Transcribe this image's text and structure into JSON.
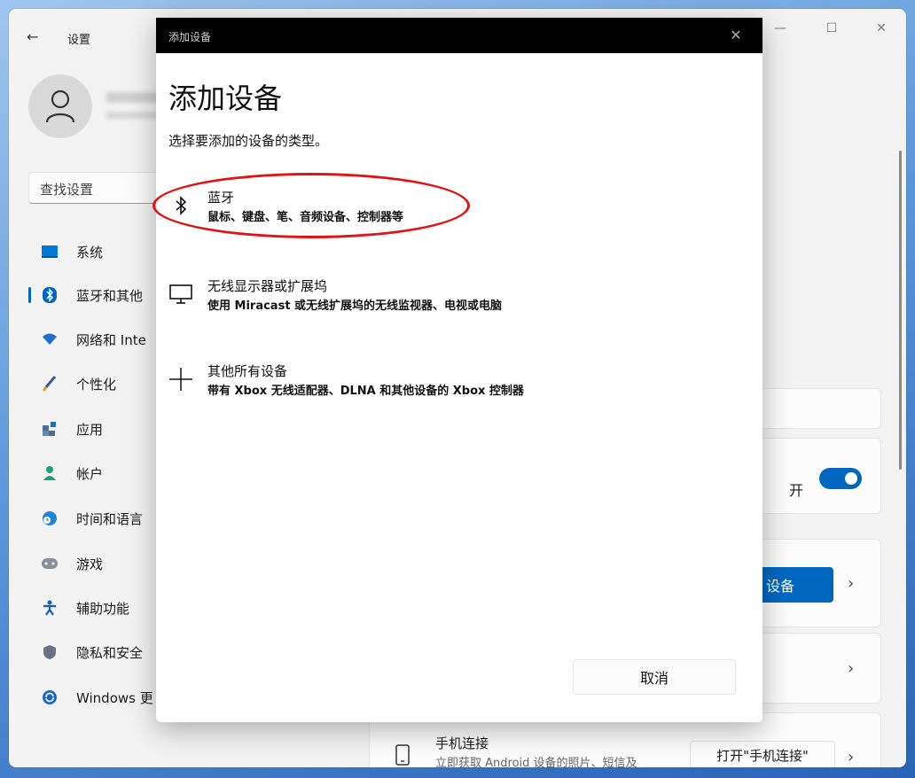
{
  "settings_window": {
    "title": "设置",
    "back_icon": "←",
    "window_controls": [
      "—",
      "☐",
      "✕"
    ],
    "search_placeholder": "查找设置",
    "nav": [
      {
        "label": "系统",
        "icon": "monitor-icon",
        "color": "#0078d4"
      },
      {
        "label": "蓝牙和其他",
        "icon": "bluetooth-icon",
        "color": "#0067c0",
        "active": true
      },
      {
        "label": "网络和 Inte",
        "icon": "wifi-icon",
        "color": "#1d6fcf"
      },
      {
        "label": "个性化",
        "icon": "brush-icon",
        "color": "#3a5a9b"
      },
      {
        "label": "应用",
        "icon": "apps-icon",
        "color": "#4d6e99"
      },
      {
        "label": "帐户",
        "icon": "account-icon",
        "color": "#1aa37a"
      },
      {
        "label": "时间和语言",
        "icon": "globe-clock-icon",
        "color": "#1f85d6"
      },
      {
        "label": "游戏",
        "icon": "gamepad-icon",
        "color": "#8a8f98"
      },
      {
        "label": "辅助功能",
        "icon": "accessibility-icon",
        "color": "#1060b8"
      },
      {
        "label": "隐私和安全",
        "icon": "shield-icon",
        "color": "#6a7280"
      },
      {
        "label": "Windows 更",
        "icon": "update-icon",
        "color": "#1668c4"
      }
    ],
    "toggle_label": "开",
    "add_device_label": "设备",
    "phone_link": {
      "title": "手机连接",
      "desc": "立即获取 Android 设备的照片、短信及",
      "button": "打开\"手机连接\""
    }
  },
  "dialog": {
    "title_bar": "添加设备",
    "heading": "添加设备",
    "subtitle": "选择要添加的设备的类型。",
    "options": [
      {
        "title": "蓝牙",
        "desc": "鼠标、键盘、笔、音频设备、控制器等",
        "icon": "bluetooth-icon"
      },
      {
        "title": "无线显示器或扩展坞",
        "desc": "使用 Miracast 或无线扩展坞的无线监视器、电视或电脑",
        "icon": "display-icon"
      },
      {
        "title": "其他所有设备",
        "desc": "带有 Xbox 无线适配器、DLNA 和其他设备的 Xbox 控制器",
        "icon": "plus-icon"
      }
    ],
    "cancel": "取消",
    "close_icon": "✕"
  },
  "colors": {
    "accent": "#0067c0",
    "annotation": "#e01414"
  }
}
